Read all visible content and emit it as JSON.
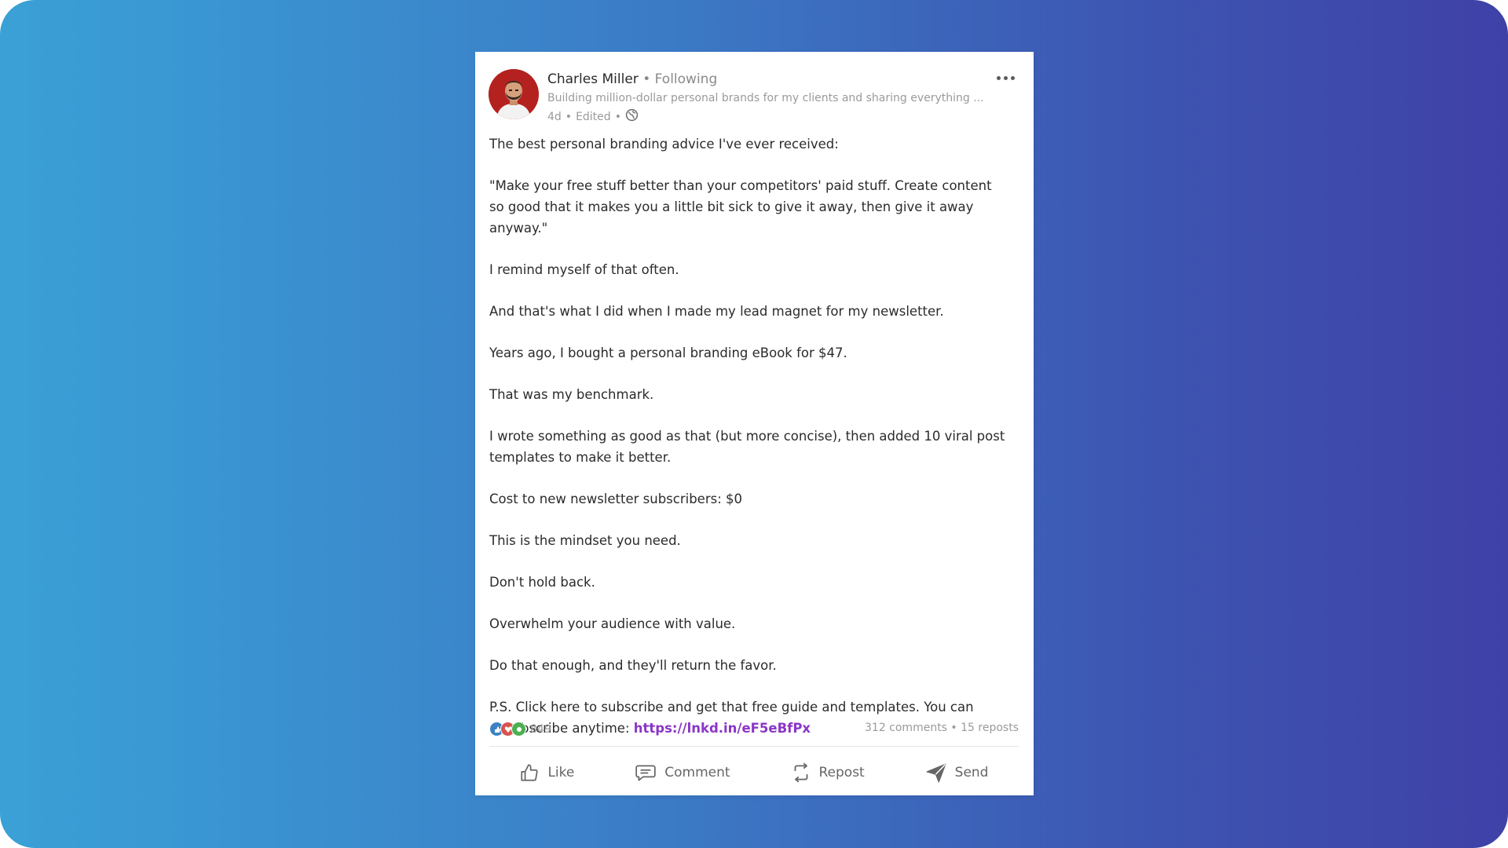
{
  "post": {
    "author": "Charles Miller",
    "separator": "•",
    "follow_status": "Following",
    "headline": "Building million-dollar personal brands for my clients and sharing everything ...",
    "age": "4d",
    "edited": "Edited",
    "meta_separator": "•",
    "paragraphs": [
      "The best personal branding advice I've ever received:",
      "\"Make your free stuff better than your competitors' paid stuff. Create content so good that it makes you a little bit sick to give it away, then give it away anyway.\"",
      "I remind myself of that often.",
      "And that's what I did when I made my lead magnet for my newsletter.",
      "Years ago, I bought a personal branding eBook for $47.",
      "That was my benchmark.",
      "I wrote something as good as that (but more concise), then added 10 viral post templates to make it better.",
      "Cost to new newsletter subscribers: $0",
      "This is the mindset you need.",
      "Don't hold back.",
      "Overwhelm your audience with value.",
      "Do that enough, and they'll return the favor."
    ],
    "ps_text": "P.S. Click here to subscribe and get that free guide and templates. You can unsubscribe anytime: ",
    "ps_link": "https://lnkd.in/eF5eBfPx"
  },
  "stats": {
    "reactions_count": "849",
    "comments_reposts": "312 comments • 15 reposts",
    "reaction_icons": [
      "like-reaction-icon",
      "love-reaction-icon",
      "support-reaction-icon"
    ]
  },
  "actions": {
    "like": "Like",
    "comment": "Comment",
    "repost": "Repost",
    "send": "Send"
  },
  "colors": {
    "link": "#8a36c7",
    "gradient_start": "#3aa1d6",
    "gradient_end": "#3f41a7",
    "like_reaction": "#3b82c4",
    "love_reaction": "#d9534f",
    "support_reaction": "#4caf50"
  }
}
